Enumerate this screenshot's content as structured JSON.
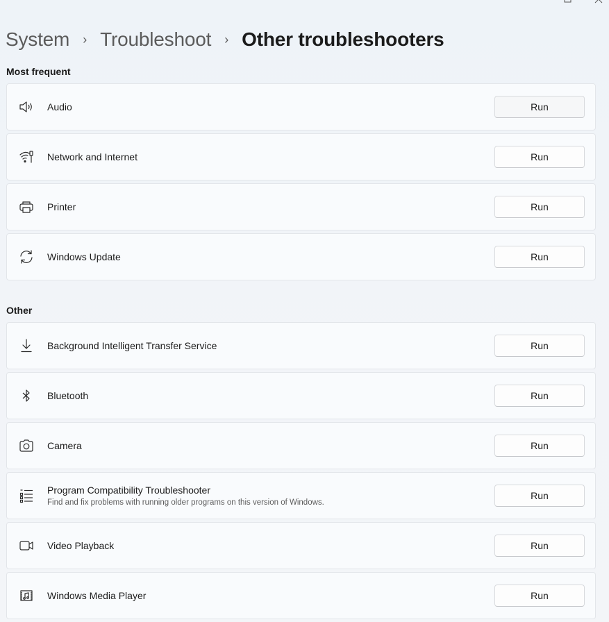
{
  "window": {
    "controls": [
      "restore-icon",
      "close-icon"
    ]
  },
  "breadcrumb": {
    "items": [
      "System",
      "Troubleshoot"
    ],
    "separator": "›",
    "current": "Other troubleshooters"
  },
  "most_frequent": {
    "title": "Most frequent",
    "items": [
      {
        "icon": "speaker-icon",
        "title": "Audio",
        "button": "Run"
      },
      {
        "icon": "network-icon",
        "title": "Network and Internet",
        "button": "Run"
      },
      {
        "icon": "printer-icon",
        "title": "Printer",
        "button": "Run"
      },
      {
        "icon": "sync-icon",
        "title": "Windows Update",
        "button": "Run"
      }
    ]
  },
  "other": {
    "title": "Other",
    "items": [
      {
        "icon": "download-icon",
        "title": "Background Intelligent Transfer Service",
        "button": "Run"
      },
      {
        "icon": "bluetooth-icon",
        "title": "Bluetooth",
        "button": "Run"
      },
      {
        "icon": "camera-icon",
        "title": "Camera",
        "button": "Run"
      },
      {
        "icon": "list-icon",
        "title": "Program Compatibility Troubleshooter",
        "description": "Find and fix problems with running older programs on this version of Windows.",
        "button": "Run"
      },
      {
        "icon": "video-icon",
        "title": "Video Playback",
        "button": "Run"
      },
      {
        "icon": "media-player-icon",
        "title": "Windows Media Player",
        "button": "Run"
      }
    ]
  }
}
